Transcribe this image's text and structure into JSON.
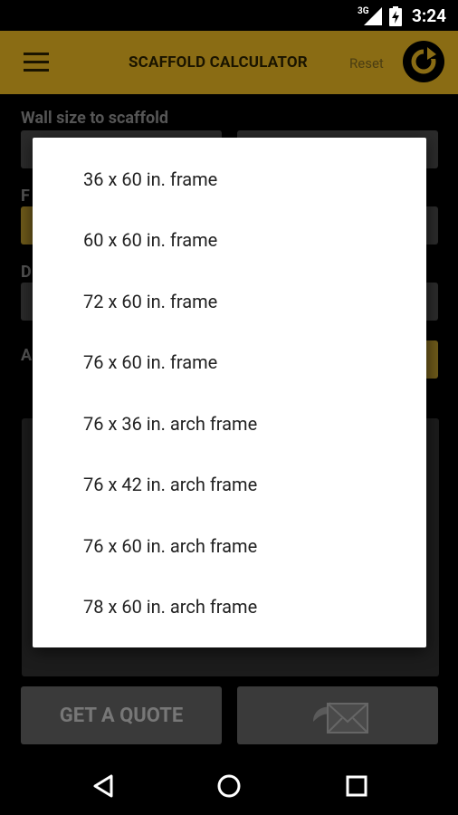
{
  "status_bar": {
    "network": "3G",
    "time": "3:24"
  },
  "app_bar": {
    "title": "SCAFFOLD CALCULATOR",
    "reset_label": "Reset"
  },
  "form": {
    "wall_size_label": "Wall size to scaffold",
    "field_initials": [
      "F",
      "D",
      "A"
    ],
    "quote_label": "GET A QUOTE"
  },
  "dialog": {
    "options": [
      "36 x 60 in. frame",
      "60 x 60 in. frame",
      "72 x 60 in. frame",
      "76 x 60 in. frame",
      "76 x 36 in. arch frame",
      "76 x 42 in. arch frame",
      "76 x 60 in. arch frame",
      "78 x 60 in. arch frame"
    ]
  },
  "colors": {
    "accent": "#f3bf22",
    "dimmed_accent": "#8a6c14",
    "background": "#000000",
    "dialog_bg": "#ffffff"
  },
  "icons": {
    "menu": "menu-icon",
    "refresh": "refresh-icon",
    "email": "email-icon",
    "back": "back-icon",
    "home": "home-icon",
    "recents": "recents-icon"
  }
}
